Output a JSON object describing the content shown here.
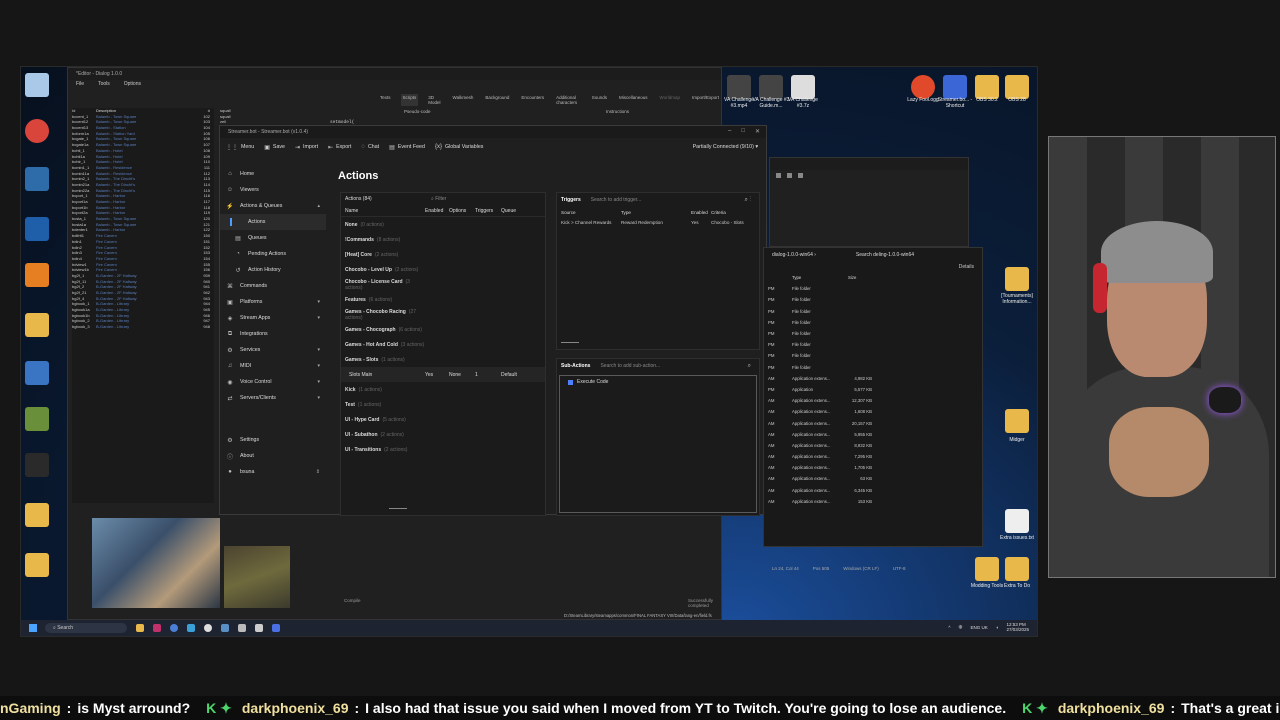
{
  "editor": {
    "title": "*Editor - Dialog 1.0.0",
    "menu": [
      "File",
      "Tools",
      "Options"
    ],
    "tabs": [
      "Texts",
      "Scripts",
      "3D Model",
      "Walkmesh",
      "Background",
      "Encounters",
      "Additional characters",
      "Sounds",
      "Miscellaneous",
      "Worldmap",
      "Import/Export"
    ],
    "code_header": "Pseudo-code",
    "instructions_header": "Instructions",
    "code_line": "setmodel(",
    "compile": "Compile",
    "status": "Successfully completed",
    "path": "D:/SteamLibrary/steamapps/common/FINAL FANTASY VIII/Data/lang-en/field.fs",
    "list_header": {
      "id": "Id",
      "desc": "Description",
      "num": "#"
    },
    "list_rows": [
      {
        "id": "bccent_1",
        "desc": "Balamb - Town Square",
        "num": "102"
      },
      {
        "id": "bccent12",
        "desc": "Balamb - Town Square",
        "num": "103"
      },
      {
        "id": "bccent13",
        "desc": "Balamb - Station",
        "num": "104"
      },
      {
        "id": "bcform1a",
        "desc": "Balamb - Station Yard",
        "num": "105"
      },
      {
        "id": "bcgate_1",
        "desc": "Balamb - Town Square",
        "num": "106"
      },
      {
        "id": "bcgate1a",
        "desc": "Balamb - Town Square",
        "num": "107"
      },
      {
        "id": "bchtl_1",
        "desc": "Balamb - Hotel",
        "num": "108"
      },
      {
        "id": "bchtl1a",
        "desc": "Balamb - Hotel",
        "num": "109"
      },
      {
        "id": "bchtr_1",
        "desc": "Balamb - Hotel",
        "num": "110"
      },
      {
        "id": "bcmin1_1",
        "desc": "Balamb - Residence",
        "num": "111"
      },
      {
        "id": "bcmin11a",
        "desc": "Balamb - Residence",
        "num": "112"
      },
      {
        "id": "bcmin2_1",
        "desc": "Balamb - The Dincht's",
        "num": "113"
      },
      {
        "id": "bcmin21a",
        "desc": "Balamb - The Dincht's",
        "num": "114"
      },
      {
        "id": "bcmin22a",
        "desc": "Balamb - The Dincht's",
        "num": "115"
      },
      {
        "id": "bcport_1",
        "desc": "Balamb - Harbor",
        "num": "116"
      },
      {
        "id": "bcport1a",
        "desc": "Balamb - Harbor",
        "num": "117"
      },
      {
        "id": "bcport1b",
        "desc": "Balamb - Harbor",
        "num": "118"
      },
      {
        "id": "bcport2a",
        "desc": "Balamb - Harbor",
        "num": "119"
      },
      {
        "id": "bcsta_1",
        "desc": "Balamb - Town Square",
        "num": "120"
      },
      {
        "id": "bcsta1a",
        "desc": "Balamb - Town Square",
        "num": "121"
      },
      {
        "id": "bdenter1",
        "desc": "Balamb - Harbor",
        "num": "122"
      },
      {
        "id": "bdifrit1",
        "desc": "Fire Cavern",
        "num": "150"
      },
      {
        "id": "bdin1",
        "desc": "Fire Cavern",
        "num": "151"
      },
      {
        "id": "bdin2",
        "desc": "Fire Cavern",
        "num": "152"
      },
      {
        "id": "bdin3",
        "desc": "Fire Cavern",
        "num": "153"
      },
      {
        "id": "bdin4",
        "desc": "Fire Cavern",
        "num": "154"
      },
      {
        "id": "bdview1",
        "desc": "Fire Cavern",
        "num": "155"
      },
      {
        "id": "bdview1b",
        "desc": "Fire Cavern",
        "num": "156"
      },
      {
        "id": "bg2f_1",
        "desc": "B-Garden - 2F Hallway",
        "num": "939"
      },
      {
        "id": "bg2f_11",
        "desc": "B-Garden - 2F Hallway",
        "num": "940"
      },
      {
        "id": "bg2f_2",
        "desc": "B-Garden - 2F Hallway",
        "num": "941"
      },
      {
        "id": "bg2f_21",
        "desc": "B-Garden - 2F Hallway",
        "num": "942"
      },
      {
        "id": "bg2f_4",
        "desc": "B-Garden - 2F Hallway",
        "num": "943"
      },
      {
        "id": "bgbook_1",
        "desc": "B-Garden - Library",
        "num": "944"
      },
      {
        "id": "bgbook1a",
        "desc": "B-Garden - Library",
        "num": "945"
      },
      {
        "id": "bgbook1b",
        "desc": "B-Garden - Library",
        "num": "946"
      },
      {
        "id": "bgbook_2",
        "desc": "B-Garden - Library",
        "num": "947"
      },
      {
        "id": "bgbook_3",
        "desc": "B-Garden - Library",
        "num": "948"
      }
    ],
    "entities": [
      "squall",
      "squall",
      "zell",
      "quistis",
      "irvine",
      "selphie",
      "rinoa",
      "seifer",
      "check",
      "nuhu",
      "pangi1",
      "pangi2",
      "dic",
      "lead",
      "cardgame",
      "cardgame",
      "elevator",
      "elavtor",
      "elkup",
      "elevator",
      "orangelight",
      "greenlight",
      "elvbose"
    ]
  },
  "streamerbot": {
    "title": "Streamer.bot - Streamer.bot (v1.0.4)",
    "toolbar": [
      {
        "icon": "grid-icon",
        "label": "Menu"
      },
      {
        "icon": "save-icon",
        "label": "Save"
      },
      {
        "icon": "import-icon",
        "label": "Import"
      },
      {
        "icon": "export-icon",
        "label": "Export"
      },
      {
        "icon": "chat-icon",
        "label": "Chat"
      },
      {
        "icon": "event-feed-icon",
        "label": "Event Feed"
      },
      {
        "icon": "variables-icon",
        "label": "Global Variables"
      }
    ],
    "connection": "Partially Connected (9/10) ▾",
    "nav": [
      {
        "label": "Home",
        "icon": "⌂",
        "sub": false,
        "chev": ""
      },
      {
        "label": "Viewers",
        "icon": "☺",
        "sub": false,
        "chev": ""
      },
      {
        "label": "Actions & Queues",
        "icon": "⚡",
        "sub": false,
        "chev": "▴"
      },
      {
        "label": "Actions",
        "icon": "",
        "sub": true,
        "chev": "",
        "active": true
      },
      {
        "label": "Queues",
        "icon": "▤",
        "sub": true,
        "chev": ""
      },
      {
        "label": "Pending Actions",
        "icon": "◔",
        "sub": true,
        "chev": ""
      },
      {
        "label": "Action History",
        "icon": "↺",
        "sub": true,
        "chev": ""
      },
      {
        "label": "Commands",
        "icon": "⌘",
        "sub": false,
        "chev": ""
      },
      {
        "label": "Platforms",
        "icon": "▣",
        "sub": false,
        "chev": "▾"
      },
      {
        "label": "Stream Apps",
        "icon": "◈",
        "sub": false,
        "chev": "▾"
      },
      {
        "label": "Integrations",
        "icon": "⧉",
        "sub": false,
        "chev": ""
      },
      {
        "label": "Services",
        "icon": "⚙",
        "sub": false,
        "chev": "▾"
      },
      {
        "label": "MIDI",
        "icon": "♫",
        "sub": false,
        "chev": "▾"
      },
      {
        "label": "Voice Control",
        "icon": "◉",
        "sub": false,
        "chev": "▾"
      },
      {
        "label": "Servers/Clients",
        "icon": "⇄",
        "sub": false,
        "chev": "▾"
      }
    ],
    "nav_bottom": [
      {
        "label": "Settings",
        "icon": "⚙"
      },
      {
        "label": "About",
        "icon": "ⓘ"
      },
      {
        "label": "bsuna",
        "icon": "●"
      }
    ],
    "heading": "Actions",
    "actions_panel": {
      "title": "Actions (84)",
      "filter": "Filter",
      "columns": [
        "Name",
        "Enabled",
        "Options",
        "Triggers",
        "Queue"
      ],
      "groups": [
        {
          "name": "None",
          "count": "(0 actions)"
        },
        {
          "name": "!Commands",
          "count": "(8 actions)"
        },
        {
          "name": "[Heat] Core",
          "count": "(2 actions)"
        },
        {
          "name": "Chocobo - Level Up",
          "count": "(2 actions)"
        },
        {
          "name": "Chocobo - License Card",
          "count": "(3 actions)"
        },
        {
          "name": "Features",
          "count": "(6 actions)"
        },
        {
          "name": "Games - Chocobo Racing",
          "count": "(27 actions)"
        },
        {
          "name": "Games - Chocograph",
          "count": "(6 actions)"
        },
        {
          "name": "Games - Hot And Cold",
          "count": "(3 actions)"
        },
        {
          "name": "Games - Slots",
          "count": "(1 actions)"
        }
      ],
      "action_row": {
        "name": "Slots Main",
        "enabled": "Yes",
        "options": "None",
        "triggers": "1",
        "queue": "Default"
      },
      "groups_after": [
        {
          "name": "Kick",
          "count": "(1 actions)"
        },
        {
          "name": "Test",
          "count": "(1 actions)"
        },
        {
          "name": "UI - Hype Card",
          "count": "(5 actions)"
        },
        {
          "name": "UI - Subathon",
          "count": "(2 actions)"
        },
        {
          "name": "UI - Transitions",
          "count": "(2 actions)"
        }
      ]
    },
    "triggers_panel": {
      "title": "Triggers",
      "search": "Search to add trigger...",
      "columns": [
        "Source",
        "Type",
        "Enabled",
        "Criteria"
      ],
      "rows": [
        {
          "source": "Kick > Channel Rewards",
          "type": "Reward Redemption",
          "enabled": "Yes",
          "criteria": "Chocobo - Slots"
        }
      ]
    },
    "sub_panel": {
      "title": "Sub-Actions",
      "search": "Search to add sub-action...",
      "items": [
        "Execute Code"
      ]
    }
  },
  "explorer": {
    "path": "dialog-1.0.0-win64  ›",
    "search": "Search deling-1.0.0-win64",
    "details": "Details",
    "columns": [
      "Type",
      "Size"
    ],
    "rows": [
      {
        "c1": "PM",
        "type": "File folder",
        "size": ""
      },
      {
        "c1": "PM",
        "type": "File folder",
        "size": ""
      },
      {
        "c1": "PM",
        "type": "File folder",
        "size": ""
      },
      {
        "c1": "PM",
        "type": "File folder",
        "size": ""
      },
      {
        "c1": "PM",
        "type": "File folder",
        "size": ""
      },
      {
        "c1": "PM",
        "type": "File folder",
        "size": ""
      },
      {
        "c1": "PM",
        "type": "File folder",
        "size": ""
      },
      {
        "c1": "PM",
        "type": "File folder",
        "size": ""
      },
      {
        "c1": "AM",
        "type": "Application extens...",
        "size": "4,982 KB"
      },
      {
        "c1": "PM",
        "type": "Application",
        "size": "5,577 KB"
      },
      {
        "c1": "AM",
        "type": "Application extens...",
        "size": "12,307 KB"
      },
      {
        "c1": "AM",
        "type": "Application extens...",
        "size": "1,608 KB"
      },
      {
        "c1": "AM",
        "type": "Application extens...",
        "size": "20,157 KB"
      },
      {
        "c1": "AM",
        "type": "Application extens...",
        "size": "5,955 KB"
      },
      {
        "c1": "AM",
        "type": "Application extens...",
        "size": "8,932 KB"
      },
      {
        "c1": "AM",
        "type": "Application extens...",
        "size": "7,295 KB"
      },
      {
        "c1": "AM",
        "type": "Application extens...",
        "size": "1,705 KB"
      },
      {
        "c1": "AM",
        "type": "Application extens...",
        "size": "63 KB"
      },
      {
        "c1": "AM",
        "type": "Application extens...",
        "size": "6,345 KB"
      },
      {
        "c1": "AM",
        "type": "Application extens...",
        "size": "153 KB"
      }
    ],
    "statusbar": [
      "Ln 24, Col 44",
      "Pos 505",
      "Windows (CR LF)",
      "UTF-8"
    ]
  },
  "desktop": {
    "icons_top": [
      "VA Challenge #3.mp4",
      "VA Challenge #3 Guide.m...",
      "VA Challenge #3.7z"
    ],
    "icons_right": [
      "Lazy Fool.ogg",
      "Streamer.bo... - Shortcut",
      "OBS 30.2",
      "OBS 28"
    ],
    "icons_side": [
      "[Tournaments] Information...",
      "Midger",
      "Modding Tools",
      "Extra To Do",
      "Extra issues.txt"
    ]
  },
  "taskbar": {
    "search": "Search",
    "lang": "ENG UK",
    "time": "12:53 PM",
    "date": "27/03/2025"
  },
  "ticker": [
    {
      "user": "nGaming",
      "msg": "is Myst arround?"
    },
    {
      "user": "darkphoenix_69",
      "msg": "I also had that issue you said when I moved from YT to Twitch. You're going to lose an audience."
    },
    {
      "user": "darkphoenix_69",
      "msg": "That's a great idea."
    }
  ],
  "colors": {
    "accent": "#4d9cff",
    "ticker_sep": "#4cd66b",
    "mic_glow": "#a35cff"
  }
}
